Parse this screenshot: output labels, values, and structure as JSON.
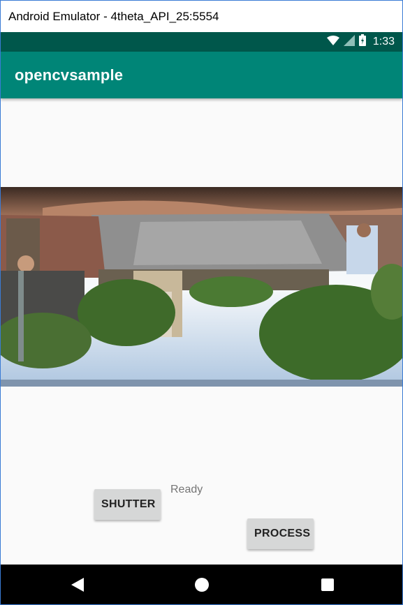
{
  "window": {
    "title": "Android Emulator - 4theta_API_25:5554"
  },
  "status_bar": {
    "time": "1:33",
    "icons": [
      "wifi-icon",
      "cell-signal-icon",
      "battery-icon"
    ]
  },
  "app_bar": {
    "title": "opencvsample"
  },
  "main": {
    "image": "panorama-photo",
    "status_text": "Ready",
    "shutter_label": "SHUTTER",
    "process_label": "PROCESS"
  },
  "nav_bar": {
    "icons": [
      "back-icon",
      "home-icon",
      "recents-icon"
    ]
  },
  "colors": {
    "status_bar": "#00574b",
    "app_bar": "#008577",
    "button": "#d6d7d7",
    "background": "#fafafa"
  }
}
